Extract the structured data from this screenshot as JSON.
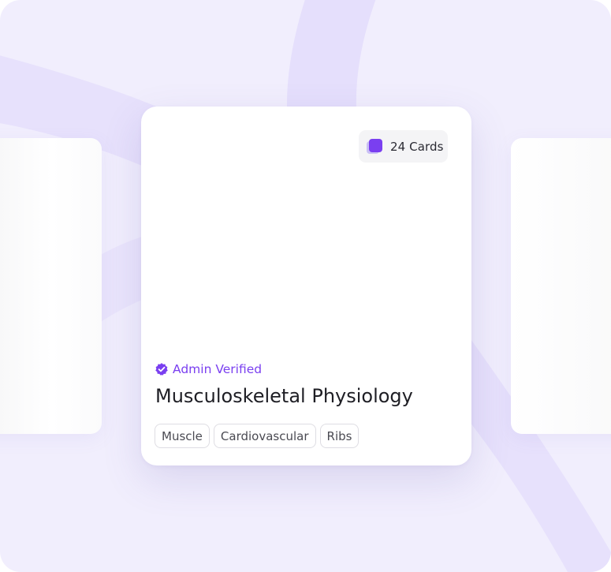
{
  "deck": {
    "card_count_label": "24 Cards",
    "verified_label": "Admin Verified",
    "title": "Musculoskeletal Physiology",
    "tags": [
      "Muscle",
      "Cardiovascular",
      "Ribs"
    ]
  },
  "icons": {
    "card_stack": "card-stack-icon",
    "verified": "verified-badge-icon"
  },
  "colors": {
    "accent": "#7a3ff0",
    "background": "#f1eefd",
    "card": "#ffffff",
    "pill_background": "#f4f4f6",
    "tag_border": "#dedde3"
  }
}
